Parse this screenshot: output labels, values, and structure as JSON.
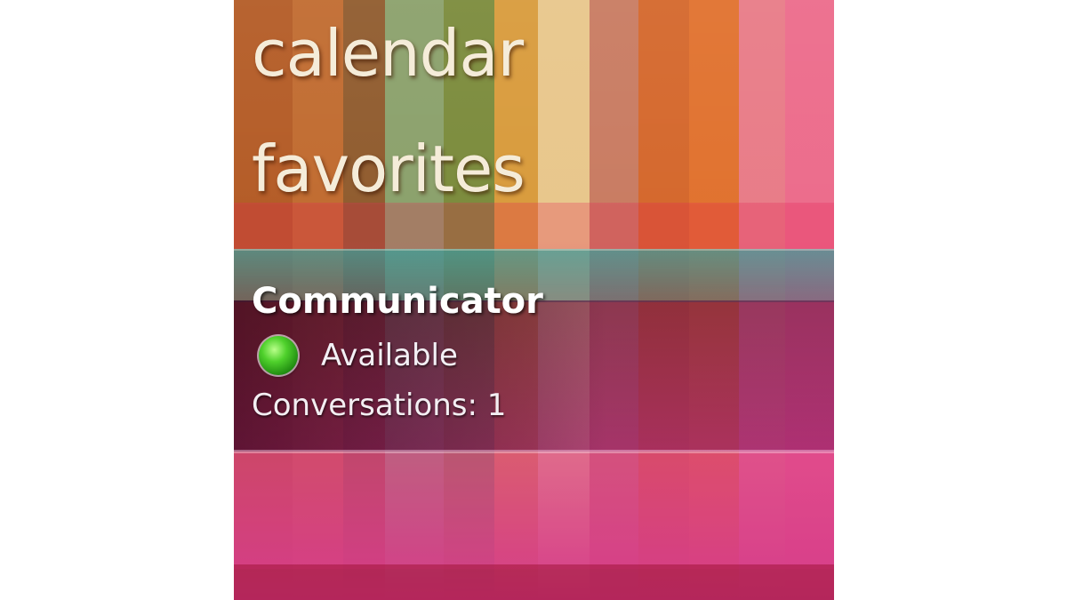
{
  "background": {
    "stripe_colors": [
      "#b35a24",
      "#c06a2e",
      "#8f5a2c",
      "#8aa06a",
      "#7a8a3a",
      "#d89a3a",
      "#e8c68a",
      "#c87a60",
      "#d4662a",
      "#e0702c",
      "#e87a86",
      "#ec6a8a"
    ]
  },
  "tiles": {
    "calendar_label": "calendar",
    "favorites_label": "favorites"
  },
  "communicator": {
    "title": "Communicator",
    "status": "Available",
    "status_color": "#4fd12c",
    "conversations": "Conversations: 1"
  }
}
